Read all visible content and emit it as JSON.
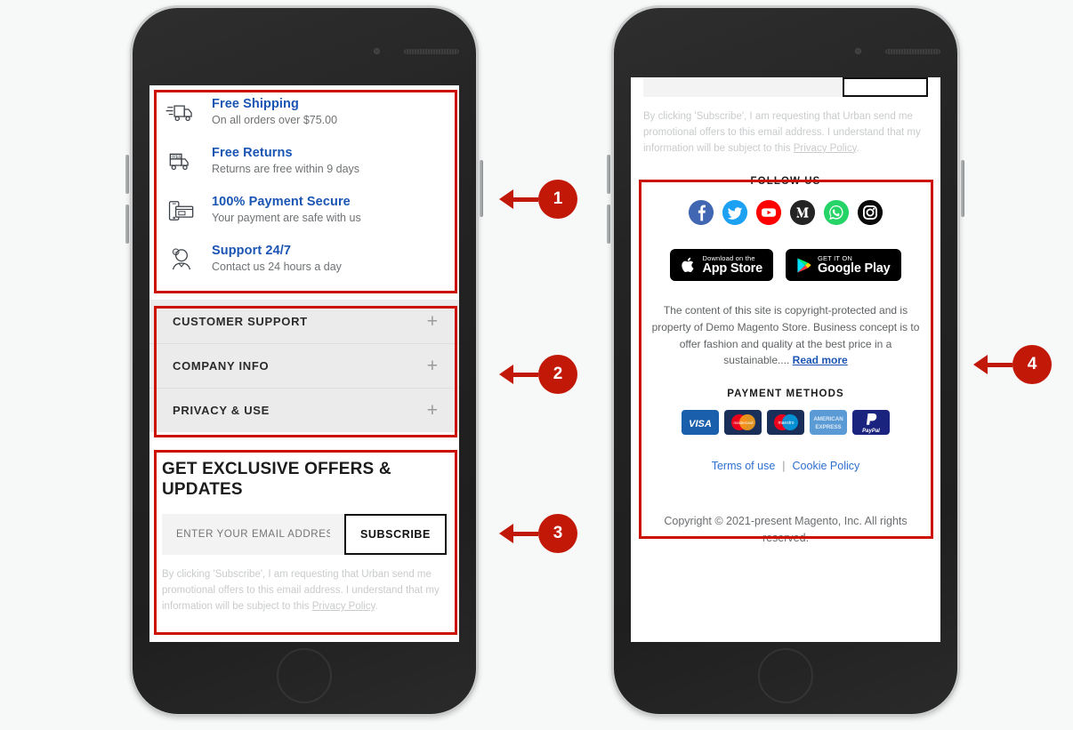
{
  "callouts": [
    {
      "number": "1"
    },
    {
      "number": "2"
    },
    {
      "number": "3"
    },
    {
      "number": "4"
    }
  ],
  "left_screen": {
    "features": [
      {
        "icon": "delivery-truck-icon",
        "title": "Free Shipping",
        "desc": "On all orders over $75.00"
      },
      {
        "icon": "free-returns-truck-icon",
        "title": "Free Returns",
        "desc": "Returns are free within 9 days"
      },
      {
        "icon": "payment-secure-icon",
        "title": "100% Payment Secure",
        "desc": "Your payment are safe with us"
      },
      {
        "icon": "support-agent-icon",
        "title": "Support 24/7",
        "desc": "Contact us 24 hours a day"
      }
    ],
    "accordion": [
      {
        "label": "CUSTOMER SUPPORT",
        "expand_icon": "plus-icon"
      },
      {
        "label": "COMPANY INFO",
        "expand_icon": "plus-icon"
      },
      {
        "label": "PRIVACY & USE",
        "expand_icon": "plus-icon"
      }
    ],
    "newsletter": {
      "title": "GET EXCLUSIVE OFFERS & UPDATES",
      "email_placeholder": "ENTER YOUR EMAIL ADDRESS",
      "email_value": "",
      "subscribe_label": "SUBSCRIBE",
      "disclaimer_before": "By clicking 'Subscribe', I am requesting that Urban send me promotional offers to this email address. I understand that my information will be subject to this ",
      "disclaimer_link": "Privacy Policy",
      "disclaimer_after": "."
    }
  },
  "right_screen": {
    "newsletter_disclaimer": {
      "before": "By clicking 'Subscribe', I am requesting that Urban send me promotional offers to this email address. I understand that my information will be subject to this ",
      "link": "Privacy Policy",
      "after": "."
    },
    "follow_us": {
      "heading": "FOLLOW US",
      "icons": [
        {
          "name": "facebook-icon",
          "color": "#4267B2"
        },
        {
          "name": "twitter-icon",
          "color": "#1DA1F2"
        },
        {
          "name": "youtube-icon",
          "color": "#FF0000"
        },
        {
          "name": "medium-icon",
          "color": "#242424"
        },
        {
          "name": "whatsapp-icon",
          "color": "#25D366"
        },
        {
          "name": "instagram-icon",
          "color": "#0A0A0A"
        }
      ]
    },
    "app_stores": [
      {
        "icon": "apple-icon",
        "small": "Download on the",
        "big": "App Store"
      },
      {
        "icon": "google-play-icon",
        "small": "GET IT ON",
        "big": "Google Play"
      }
    ],
    "about": {
      "text": "The content of this site is copyright-protected and is property of Demo Magento Store. Business concept is to offer fashion and quality at the best price in a sustainable.... ",
      "read_more": "Read more"
    },
    "payment": {
      "heading": "PAYMENT METHODS",
      "cards": [
        {
          "name": "visa-card",
          "label": "VISA",
          "bg": "#1A5FAC"
        },
        {
          "name": "mastercard-card",
          "label": "mastercard",
          "bg": "#1A2E5A"
        },
        {
          "name": "maestro-card",
          "label": "maestro",
          "bg": "#1A2E5A"
        },
        {
          "name": "amex-card",
          "label": "AMERICAN EXPRESS",
          "bg": "#5B9BD5"
        },
        {
          "name": "paypal-card",
          "label": "PayPal",
          "bg": "#1A237E"
        }
      ]
    },
    "bottom_links": [
      {
        "label": "Terms of use"
      },
      {
        "label": "Cookie Policy"
      }
    ],
    "links_separator": "|",
    "copyright": "Copyright © 2021-present Magento, Inc. All rights reserved."
  }
}
